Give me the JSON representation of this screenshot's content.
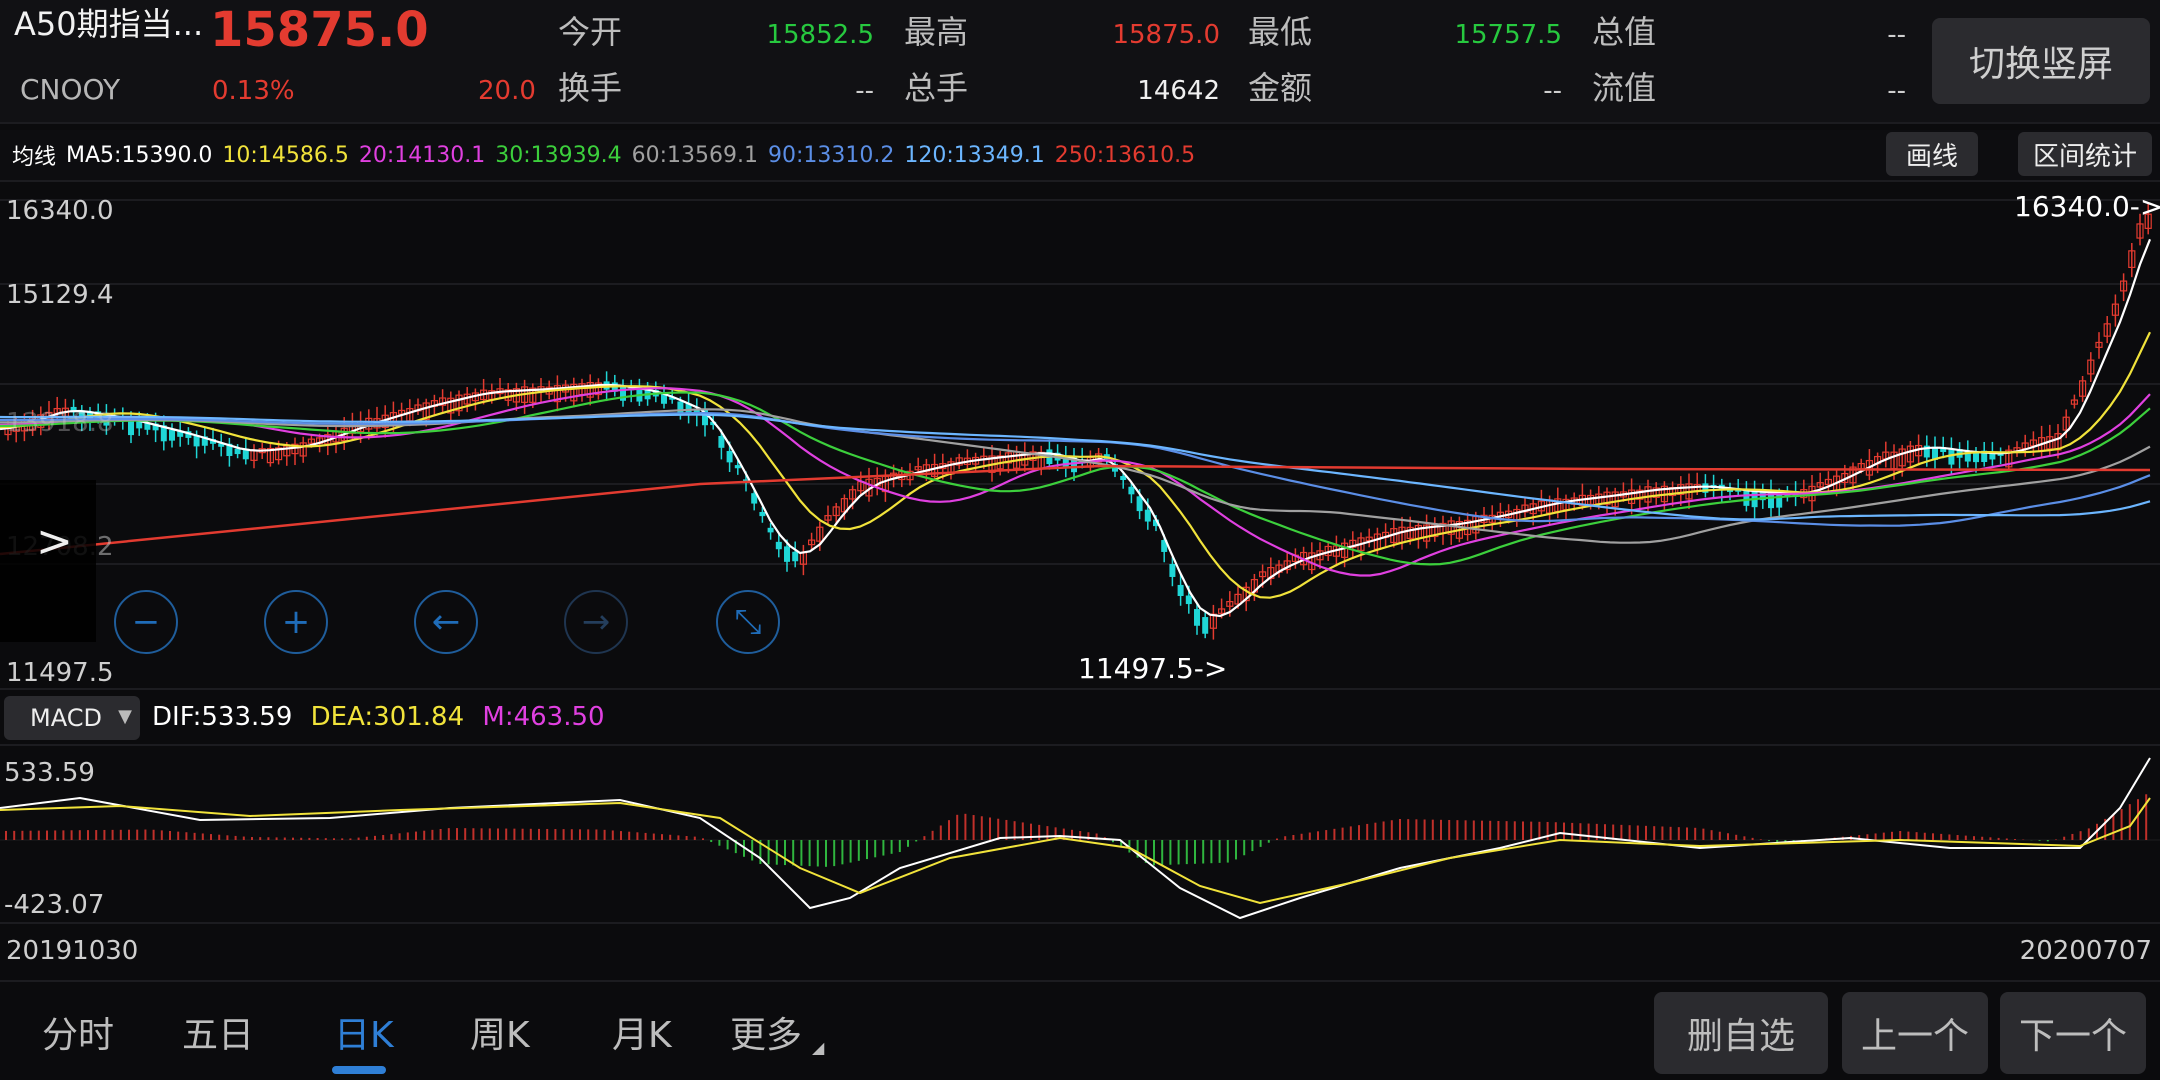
{
  "header": {
    "name": "A50期指当...",
    "price": "15875.0",
    "code": "CNOOY",
    "change_pct": "0.13%",
    "change": "20.0",
    "stats": [
      {
        "label": "今开",
        "value": "15852.5",
        "color": "#27c93f"
      },
      {
        "label": "最高",
        "value": "15875.0",
        "color": "#e33b30"
      },
      {
        "label": "最低",
        "value": "15757.5",
        "color": "#27c93f"
      },
      {
        "label": "总值",
        "value": "--",
        "color": "#cfcfcf"
      },
      {
        "label": "换手",
        "value": "--",
        "color": "#cfcfcf"
      },
      {
        "label": "总手",
        "value": "14642",
        "color": "#f0f0f0"
      },
      {
        "label": "金额",
        "value": "--",
        "color": "#cfcfcf"
      },
      {
        "label": "流值",
        "value": "--",
        "color": "#cfcfcf"
      }
    ],
    "switch_label": "切换竖屏"
  },
  "ma_row": {
    "title": "均线",
    "items": [
      {
        "text": "MA5:15390.0",
        "color": "#ffffff"
      },
      {
        "text": "10:14586.5",
        "color": "#f1e33b"
      },
      {
        "text": "20:14130.1",
        "color": "#e040e0"
      },
      {
        "text": "30:13939.4",
        "color": "#3ccf3c"
      },
      {
        "text": "60:13569.1",
        "color": "#a0a0a0"
      },
      {
        "text": "90:13310.2",
        "color": "#5b8ee6"
      },
      {
        "text": "120:13349.1",
        "color": "#6cb6ff"
      },
      {
        "text": "250:13610.5",
        "color": "#e33b30"
      }
    ],
    "draw_btn": "画线",
    "stats_btn": "区间统计"
  },
  "price_axis": {
    "top": "16340.0",
    "second": "15129.4",
    "third": "13918.8",
    "fourth": "12708.2",
    "bottom": "11497.5"
  },
  "markers": {
    "high": "16340.0->",
    "low": "11497.5->"
  },
  "controls": [
    {
      "name": "zoom-out-icon",
      "glyph": "−",
      "disabled": false
    },
    {
      "name": "zoom-in-icon",
      "glyph": "+",
      "disabled": false
    },
    {
      "name": "scroll-left-icon",
      "glyph": "←",
      "disabled": false
    },
    {
      "name": "scroll-right-icon",
      "glyph": "→",
      "disabled": true
    },
    {
      "name": "collapse-icon",
      "glyph": "⤡",
      "disabled": false
    }
  ],
  "macd": {
    "selector": "MACD",
    "dif": "DIF:533.59",
    "dea": "DEA:301.84",
    "m": "M:463.50",
    "axis_top": "533.59",
    "axis_bottom": "-423.07"
  },
  "dates": {
    "start": "20191030",
    "end": "20200707"
  },
  "tabs": [
    {
      "label": "分时",
      "active": false
    },
    {
      "label": "五日",
      "active": false
    },
    {
      "label": "日K",
      "active": true
    },
    {
      "label": "周K",
      "active": false
    },
    {
      "label": "月K",
      "active": false
    },
    {
      "label": "更多",
      "active": false
    }
  ],
  "buttons": {
    "delete": "删自选",
    "prev": "上一个",
    "next": "下一个"
  },
  "colors": {
    "up": "#e33b30",
    "down": "#1fd6d6",
    "accent": "#2f7fd6"
  }
}
